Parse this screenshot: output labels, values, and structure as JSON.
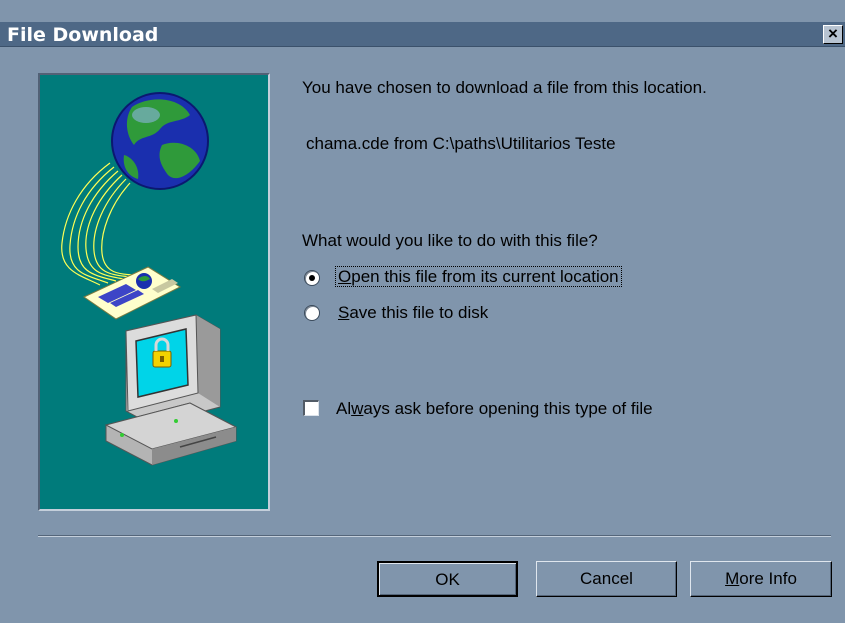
{
  "dialog": {
    "title": "File Download",
    "close_label": "×"
  },
  "message": {
    "intro": "You have chosen to download a file from this location.",
    "file_location": "chama.cde from C:\\paths\\Utilitarios Teste",
    "question": "What would you like to do with this file?"
  },
  "options": {
    "open": {
      "label_first": "O",
      "label_rest": "pen this file from its current location",
      "selected": true
    },
    "save": {
      "label_first": "S",
      "label_rest": "ave this file to disk",
      "selected": false
    }
  },
  "always_ask": {
    "label_before": "Al",
    "label_underlined": "w",
    "label_after": "ays ask before opening this type of file",
    "checked": false
  },
  "buttons": {
    "ok": "OK",
    "cancel": "Cancel",
    "more_info_first": "M",
    "more_info_rest": "ore Info"
  },
  "colors": {
    "dialog_bg": "#8095ac",
    "titlebar": "#4e6886",
    "art_bg": "#007b7b"
  },
  "icons": [
    "globe-icon",
    "document-icon",
    "computer-lock-icon",
    "close-icon"
  ]
}
